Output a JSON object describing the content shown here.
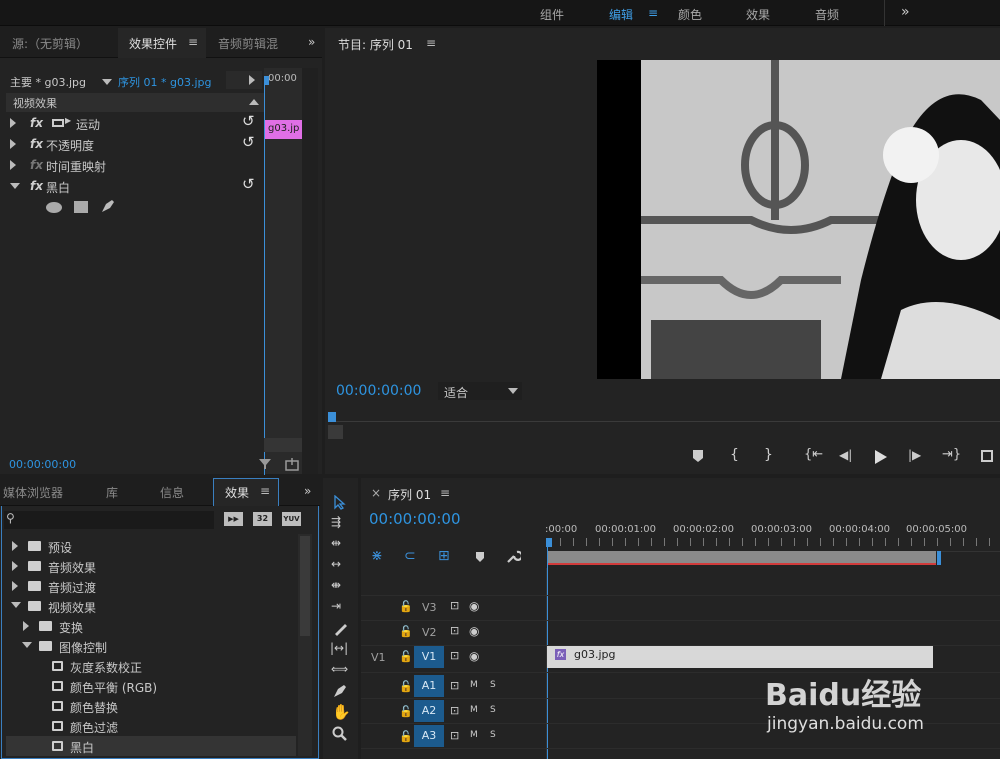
{
  "workspace": {
    "tabs": [
      "组件",
      "编辑",
      "颜色",
      "效果",
      "音频"
    ],
    "active": "编辑",
    "more": "»"
  },
  "source_panel": {
    "tabs": [
      "源:（无剪辑）",
      "效果控件",
      "音频剪辑混"
    ],
    "active_menu": "≡",
    "more": "»",
    "master": "主要 * g03.jpg",
    "sequence": "序列 01 * g03.jpg",
    "ruler_time": "00:00",
    "clip": "g03.jp",
    "section": "视频效果",
    "effects": [
      {
        "name": "运动",
        "reset": "↺"
      },
      {
        "name": "不透明度",
        "reset": "↺"
      },
      {
        "name": "时间重映射",
        "reset": ""
      },
      {
        "name": "黑白",
        "reset": "↺"
      }
    ],
    "timecode": "00:00:00:00"
  },
  "program_panel": {
    "title": "节目: 序列 01",
    "menu": "≡",
    "timecode": "00:00:00:00",
    "fit": "适合",
    "controls": [
      "marker",
      "in",
      "out",
      "go-in",
      "step-back",
      "play",
      "step-forward",
      "go-out",
      "export"
    ]
  },
  "effects_panel": {
    "tabs": [
      "媒体浏览器",
      "库",
      "信息",
      "效果"
    ],
    "active": "效果",
    "menu": "≡",
    "more": "»",
    "badges": [
      "▶▶",
      "32",
      "YUV"
    ],
    "tree": [
      {
        "label": "预设",
        "level": 0,
        "open": false,
        "type": "folder-star"
      },
      {
        "label": "音频效果",
        "level": 0,
        "open": false,
        "type": "folder"
      },
      {
        "label": "音频过渡",
        "level": 0,
        "open": false,
        "type": "folder"
      },
      {
        "label": "视频效果",
        "level": 0,
        "open": true,
        "type": "folder"
      },
      {
        "label": "变换",
        "level": 1,
        "open": false,
        "type": "folder"
      },
      {
        "label": "图像控制",
        "level": 1,
        "open": true,
        "type": "folder"
      },
      {
        "label": "灰度系数校正",
        "level": 2,
        "type": "effect"
      },
      {
        "label": "颜色平衡 (RGB)",
        "level": 2,
        "type": "effect"
      },
      {
        "label": "颜色替换",
        "level": 2,
        "type": "effect"
      },
      {
        "label": "颜色过滤",
        "level": 2,
        "type": "effect"
      },
      {
        "label": "黑白",
        "level": 2,
        "type": "effect",
        "selected": true
      }
    ]
  },
  "timeline": {
    "close": "×",
    "title": "序列 01",
    "menu": "≡",
    "timecode": "00:00:00:00",
    "ruler": [
      ":00:00",
      "00:00:01:00",
      "00:00:02:00",
      "00:00:03:00",
      "00:00:04:00",
      "00:00:05:00"
    ],
    "tracks": [
      {
        "name": "V3",
        "src": "",
        "type": "video"
      },
      {
        "name": "V2",
        "src": "",
        "type": "video"
      },
      {
        "name": "V1",
        "src": "V1",
        "type": "video",
        "active": true
      },
      {
        "name": "A1",
        "src": "",
        "type": "audio",
        "active": true
      },
      {
        "name": "A2",
        "src": "",
        "type": "audio",
        "active": true
      },
      {
        "name": "A3",
        "src": "",
        "type": "audio",
        "active": true
      }
    ],
    "clip": "g03.jpg",
    "audio_labels": {
      "m": "M",
      "s": "S"
    }
  },
  "watermark": {
    "brand": "Baidu经验",
    "url": "jingyan.baidu.com"
  }
}
